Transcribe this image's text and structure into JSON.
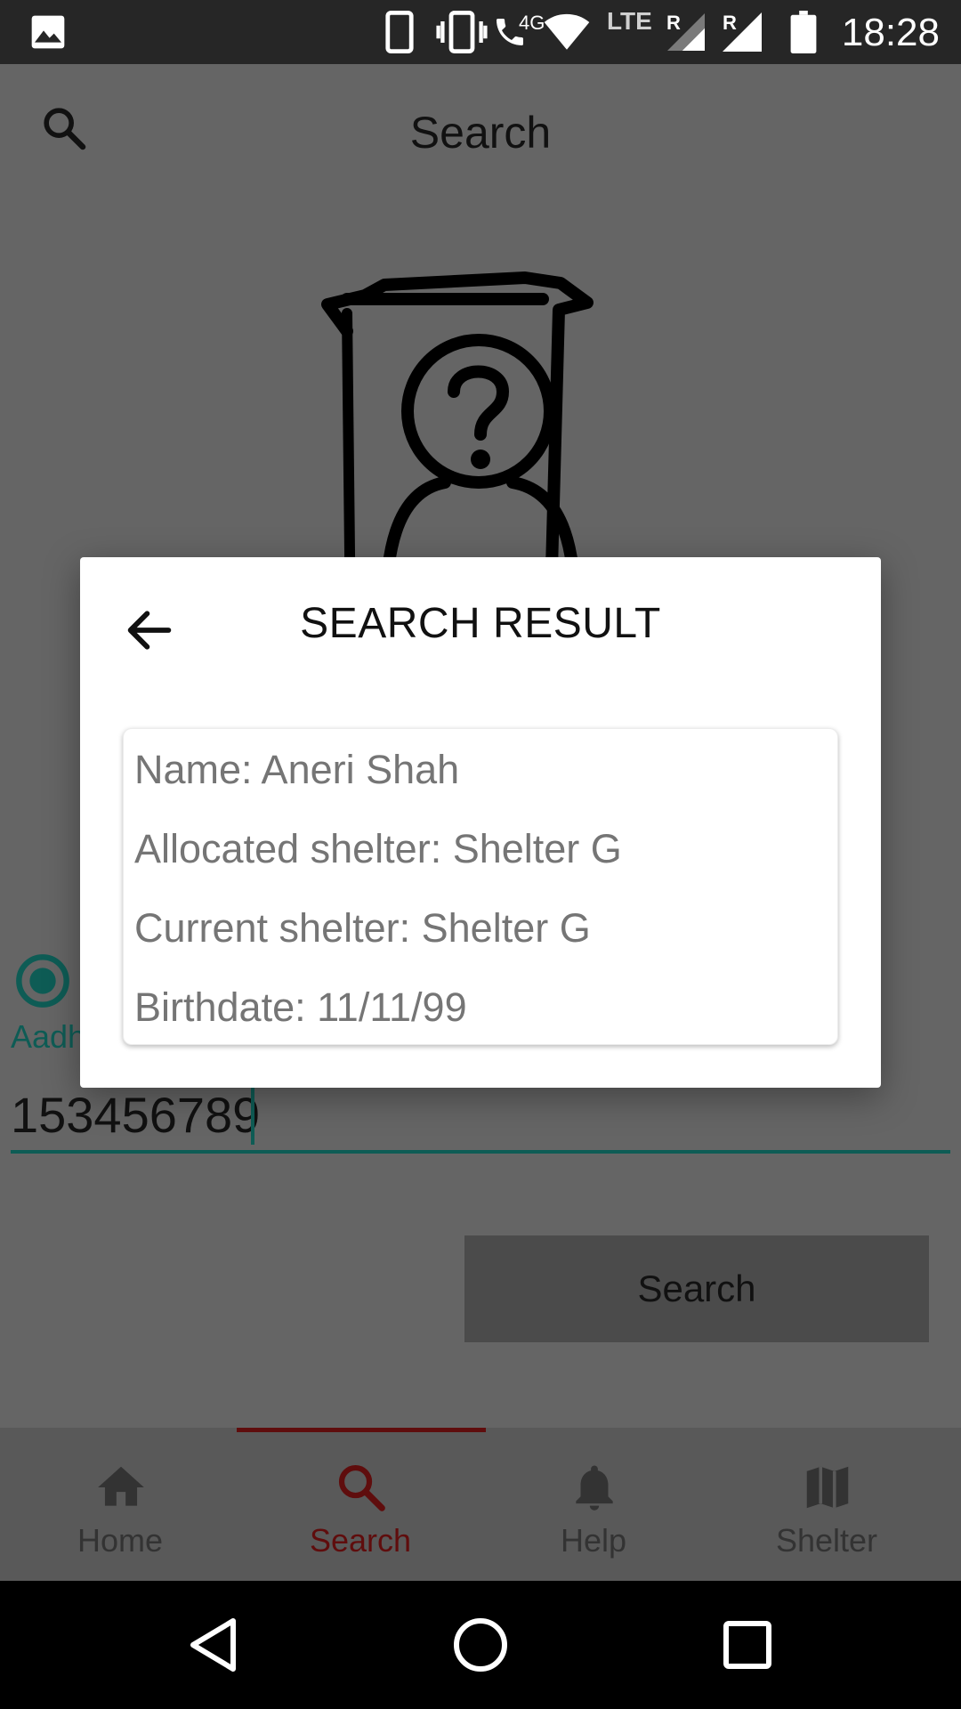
{
  "status_bar": {
    "time": "18:28",
    "network_label": "4G",
    "lte_label": "LTE",
    "roaming_1": "R",
    "roaming_2": "R"
  },
  "app_bar": {
    "title": "Search"
  },
  "form": {
    "radio_label": "Aadh",
    "aadhar_value": "153456789",
    "search_button": "Search"
  },
  "dialog": {
    "title": "SEARCH RESULT",
    "result": {
      "name": "Name: Aneri Shah",
      "allocated": "Allocated shelter: Shelter G",
      "current": "Current shelter: Shelter G",
      "birthdate": "Birthdate: 11/11/99"
    }
  },
  "bottom_nav": {
    "items": [
      {
        "label": "Home",
        "icon": "home-icon"
      },
      {
        "label": "Search",
        "icon": "search-icon"
      },
      {
        "label": "Help",
        "icon": "bell-icon"
      },
      {
        "label": "Shelter",
        "icon": "map-icon"
      }
    ],
    "active_index": 1
  },
  "colors": {
    "accent_teal": "#0e5c55",
    "active_nav": "#5f0d0d"
  }
}
